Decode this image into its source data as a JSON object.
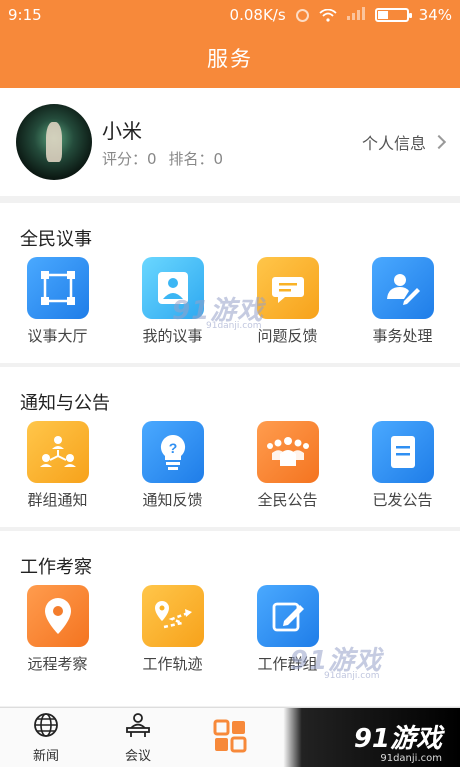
{
  "status_bar": {
    "time": "9:15",
    "speed": "0.08K/s",
    "battery": "34%"
  },
  "header": {
    "title": "服务"
  },
  "profile": {
    "name": "小米",
    "score": "评分：0",
    "rank": "排名：0",
    "link_label": "个人信息"
  },
  "sections": [
    {
      "title": "全民议事",
      "items": [
        {
          "label": "议事大厅",
          "icon": "frame-icon",
          "color": "#2f8ff2"
        },
        {
          "label": "我的议事",
          "icon": "person-icon",
          "color": "#3bb6f4"
        },
        {
          "label": "问题反馈",
          "icon": "chat-icon",
          "color": "#f9b226"
        },
        {
          "label": "事务处理",
          "icon": "user-edit-icon",
          "color": "#2f8ff2"
        }
      ]
    },
    {
      "title": "通知与公告",
      "items": [
        {
          "label": "群组通知",
          "icon": "group-icon",
          "color": "#f9b226"
        },
        {
          "label": "通知反馈",
          "icon": "question-bulb-icon",
          "color": "#2f8ff2"
        },
        {
          "label": "全民公告",
          "icon": "crowd-icon",
          "color": "#f47d2c"
        },
        {
          "label": "已发公告",
          "icon": "document-icon",
          "color": "#2f8ff2"
        }
      ]
    },
    {
      "title": "工作考察",
      "items": [
        {
          "label": "远程考察",
          "icon": "location-pin-icon",
          "color": "#f47d2c"
        },
        {
          "label": "工作轨迹",
          "icon": "route-icon",
          "color": "#f9b226"
        },
        {
          "label": "工作群组",
          "icon": "edit-icon",
          "color": "#2f8ff2"
        }
      ]
    }
  ],
  "tabbar": [
    {
      "label": "新闻",
      "icon": "globe-icon"
    },
    {
      "label": "会议",
      "icon": "meeting-icon"
    },
    {
      "label": "",
      "icon": "grid-icon",
      "active_color": "#f7893a"
    }
  ],
  "watermarks": {
    "logo_text": "91游戏",
    "site": "91danji.com"
  }
}
